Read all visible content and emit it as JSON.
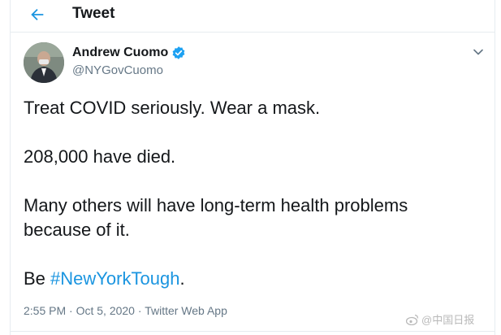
{
  "header": {
    "title": "Tweet",
    "back_icon": "arrow-left-icon"
  },
  "tweet": {
    "author": {
      "name": "Andrew Cuomo",
      "handle": "@NYGovCuomo",
      "verified": true,
      "verified_icon": "verified-badge-icon"
    },
    "more_icon": "chevron-down-icon",
    "text": {
      "line1": "Treat COVID seriously. Wear a mask.",
      "line2": "208,000 have died.",
      "line3": "Many others will have long-term health problems because of it.",
      "line4_prefix": "Be ",
      "hashtag": "#NewYorkTough",
      "line4_suffix": "."
    },
    "meta": {
      "time": "2:55 PM",
      "separator": " · ",
      "date": "Oct 5, 2020",
      "source": "Twitter Web App"
    }
  },
  "watermark": {
    "text": "@中国日报"
  },
  "colors": {
    "accent": "#1b95e0",
    "secondary_text": "#657786",
    "border": "#e6ecf0"
  }
}
